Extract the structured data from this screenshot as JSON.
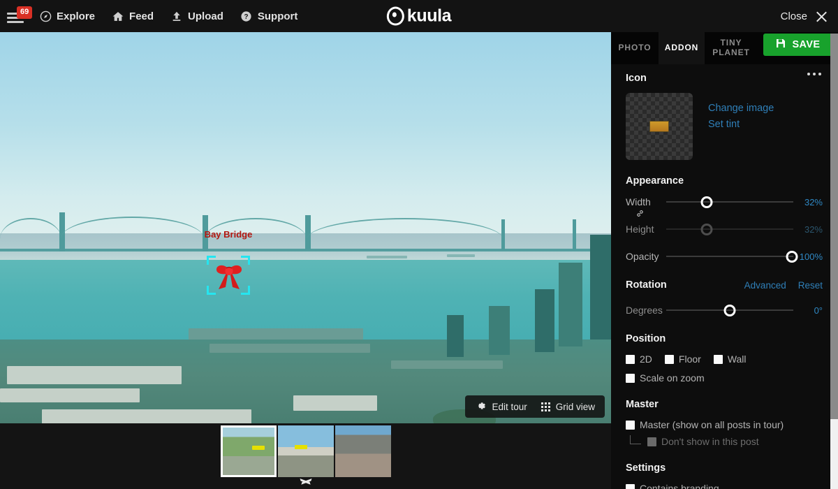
{
  "topbar": {
    "menu_badge": "69",
    "nav": [
      {
        "label": "Explore",
        "icon": "compass-icon"
      },
      {
        "label": "Feed",
        "icon": "home-icon"
      },
      {
        "label": "Upload",
        "icon": "upload-icon"
      },
      {
        "label": "Support",
        "icon": "question-circle-icon"
      }
    ],
    "logo_text": "kuula",
    "close_label": "Close"
  },
  "viewer": {
    "hotspot_label": "Bay Bridge",
    "hotspot_icon": "red-bow-icon",
    "selection_color": "#25e5f0",
    "tools": [
      {
        "label": "Edit tour",
        "icon": "gear-icon"
      },
      {
        "label": "Grid view",
        "icon": "grid-icon"
      }
    ]
  },
  "filmstrip": {
    "thumbnails": [
      {
        "name": "thumb-1",
        "active": "true"
      },
      {
        "name": "thumb-2",
        "active": "false"
      },
      {
        "name": "thumb-3",
        "active": "false"
      }
    ],
    "collapse_icon": "chevron-down-icon"
  },
  "panel": {
    "tabs": [
      {
        "label": "PHOTO",
        "active": "false"
      },
      {
        "label": "ADDON",
        "active": "true"
      },
      {
        "label": "TINY PLANET",
        "line1": "TINY",
        "line2": "PLANET",
        "active": "false"
      }
    ],
    "save_label": "SAVE",
    "save_color": "#18a22c",
    "icon_section": {
      "title": "Icon",
      "more_icon": "ellipsis-icon",
      "preview_name": "icon-thumbnail",
      "change_image_label": "Change image",
      "set_tint_label": "Set tint"
    },
    "appearance": {
      "title": "Appearance",
      "width": {
        "label": "Width",
        "value": "32%",
        "percent": 32,
        "disabled": "false"
      },
      "link_icon": "link-icon",
      "height": {
        "label": "Height",
        "value": "32%",
        "percent": 32,
        "disabled": "true"
      },
      "opacity": {
        "label": "Opacity",
        "value": "100%",
        "percent": 100,
        "disabled": "false"
      }
    },
    "rotation": {
      "title": "Rotation",
      "advanced_label": "Advanced",
      "reset_label": "Reset",
      "degrees": {
        "label": "Degrees",
        "value": "0°",
        "percent": 50
      }
    },
    "position": {
      "title": "Position",
      "options": [
        {
          "label": "2D",
          "checked": "false"
        },
        {
          "label": "Floor",
          "checked": "false"
        },
        {
          "label": "Wall",
          "checked": "false"
        }
      ],
      "scale_on_zoom": {
        "label": "Scale on zoom",
        "checked": "false"
      }
    },
    "master": {
      "title": "Master",
      "master_option": {
        "label": "Master (show on all posts in tour)",
        "checked": "false"
      },
      "sub_option": {
        "label": "Don't show in this post",
        "checked": "false",
        "disabled": "true"
      }
    },
    "settings": {
      "title": "Settings",
      "branding": {
        "label": "Contains branding",
        "checked": "false"
      }
    }
  },
  "colors": {
    "accent_link": "#2f7fb8",
    "value_blue": "#2f88c4",
    "save_green": "#18a22c",
    "badge_red": "#d93025",
    "hotspot_red": "#b3160f",
    "selection_cyan": "#25e5f0"
  }
}
